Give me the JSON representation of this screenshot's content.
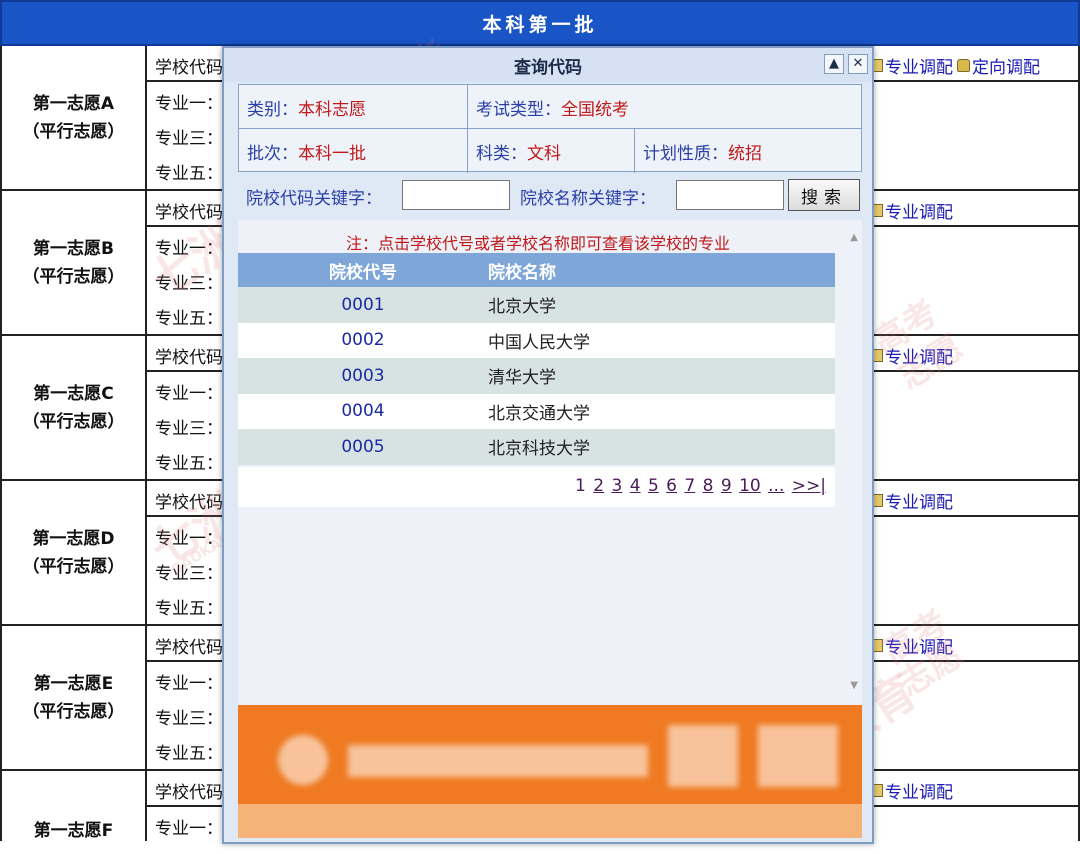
{
  "header": {
    "title": "本科第一批"
  },
  "groups": [
    {
      "name": "第一志愿A",
      "sub": "（平行志愿）",
      "school_label": "学校代码",
      "m1": "专业一：",
      "m3": "专业三：",
      "m5": "专业五：",
      "adjust": "专业调配",
      "directed": "定向调配"
    },
    {
      "name": "第一志愿B",
      "sub": "（平行志愿）",
      "school_label": "学校代码",
      "m1": "专业一：",
      "m3": "专业三：",
      "m5": "专业五：",
      "adjust": "专业调配"
    },
    {
      "name": "第一志愿C",
      "sub": "（平行志愿）",
      "school_label": "学校代码",
      "m1": "专业一：",
      "m3": "专业三：",
      "m5": "专业五：",
      "adjust": "专业调配"
    },
    {
      "name": "第一志愿D",
      "sub": "（平行志愿）",
      "school_label": "学校代码",
      "m1": "专业一：",
      "m3": "专业三：",
      "m5": "专业五：",
      "adjust": "专业调配"
    },
    {
      "name": "第一志愿E",
      "sub": "（平行志愿）",
      "school_label": "学校代码",
      "m1": "专业一：",
      "m3": "专业三：",
      "m5": "专业五：",
      "adjust": "专业调配"
    },
    {
      "name": "第一志愿F",
      "sub": "",
      "school_label": "学校代码",
      "m1": "专业一：",
      "m3": "",
      "m5": "",
      "adjust": "专业调配"
    }
  ],
  "popup": {
    "title": "查询代码",
    "minimize_icon": "▲",
    "close_icon": "✕",
    "info": {
      "category_key": "类别：",
      "category_val": "本科志愿",
      "exam_key": "考试类型：",
      "exam_val": "全国统考",
      "batch_key": "批次：",
      "batch_val": "本科一批",
      "subject_key": "科类：",
      "subject_val": "文科",
      "plan_key": "计划性质：",
      "plan_val": "统招"
    },
    "search": {
      "code_label": "院校代码关键字：",
      "name_label": "院校名称关键字：",
      "code_value": "",
      "name_value": "",
      "button": "搜索"
    },
    "note": "注：点击学校代号或者学校名称即可查看该学校的专业",
    "columns": {
      "code": "院校代号",
      "name": "院校名称"
    },
    "rows": [
      {
        "code": "0001",
        "name": "北京大学"
      },
      {
        "code": "0002",
        "name": "中国人民大学"
      },
      {
        "code": "0003",
        "name": "清华大学"
      },
      {
        "code": "0004",
        "name": "北京交通大学"
      },
      {
        "code": "0005",
        "name": "北京科技大学"
      }
    ],
    "pager": {
      "current": "1",
      "pages": [
        "2",
        "3",
        "4",
        "5",
        "6",
        "7",
        "8",
        "9",
        "10"
      ],
      "more": "...",
      "next": ">>|"
    }
  },
  "watermark": {
    "brand": "七洲教育",
    "tag1": "高考",
    "tag2": "志愿",
    "url": "GAOKAO.7ZEDU.COM"
  },
  "colors": {
    "header_bg": "#1a55c7",
    "accent_red": "#c01919",
    "label_blue": "#2b3ea6",
    "banner_orange": "#ef7a22"
  }
}
